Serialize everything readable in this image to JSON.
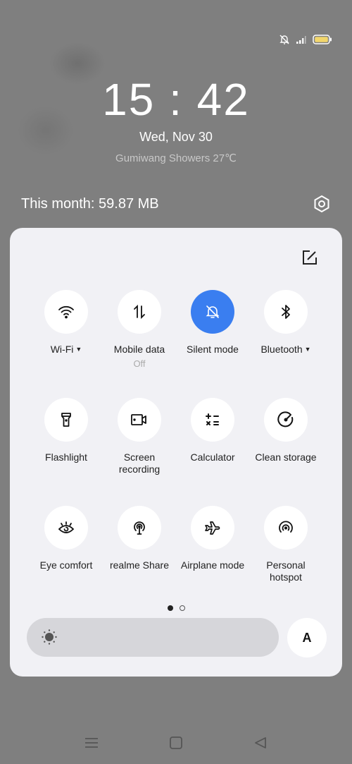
{
  "status_bar": {
    "icons": [
      "silent-bell-icon",
      "signal-icon",
      "battery-icon"
    ],
    "battery_color": "#f2d66b"
  },
  "lockscreen": {
    "time": "15:42",
    "date": "Wed, Nov 30",
    "weather": "Gumiwang Showers 27℃"
  },
  "data_usage": "This month: 59.87 MB",
  "quick_settings": {
    "accent_color": "#3a7ef0",
    "tiles": [
      {
        "label": "Wi-Fi",
        "icon": "wifi-icon",
        "has_dropdown": true,
        "active": false
      },
      {
        "label": "Mobile data",
        "sub": "Off",
        "icon": "mobile-data-icon",
        "active": false
      },
      {
        "label": "Silent mode",
        "icon": "silent-bell-icon",
        "active": true
      },
      {
        "label": "Bluetooth",
        "icon": "bluetooth-icon",
        "has_dropdown": true,
        "active": false
      },
      {
        "label": "Flashlight",
        "icon": "flashlight-icon",
        "active": false
      },
      {
        "label": "Screen",
        "label2": "recording",
        "icon": "screen-recording-icon",
        "active": false
      },
      {
        "label": "Calculator",
        "icon": "calculator-icon",
        "active": false
      },
      {
        "label": "Clean storage",
        "icon": "clean-storage-icon",
        "active": false
      },
      {
        "label": "Eye comfort",
        "icon": "eye-comfort-icon",
        "active": false
      },
      {
        "label": "realme Share",
        "icon": "realme-share-icon",
        "active": false
      },
      {
        "label": "Airplane mode",
        "icon": "airplane-icon",
        "active": false
      },
      {
        "label": "Personal",
        "label2": "hotspot",
        "icon": "hotspot-icon",
        "active": false
      }
    ],
    "page_indicator": {
      "current": 1,
      "total": 2
    },
    "brightness_level": 0.05,
    "auto_brightness_label": "A"
  },
  "nav_bar": [
    "recents-icon",
    "home-icon",
    "back-icon"
  ]
}
